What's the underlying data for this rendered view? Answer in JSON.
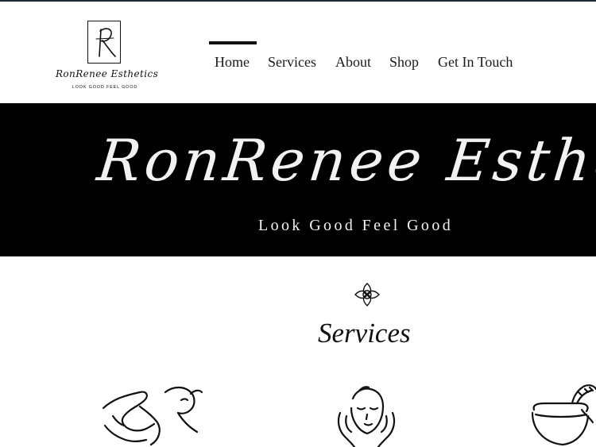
{
  "brand": {
    "logo_letter": "R",
    "name": "RonRenee Esthetics",
    "tagline": "LOOK GOOD FEEL GOOD"
  },
  "nav": {
    "items": [
      {
        "label": "Home",
        "active": true
      },
      {
        "label": "Services",
        "active": false
      },
      {
        "label": "About",
        "active": false
      },
      {
        "label": "Shop",
        "active": false
      },
      {
        "label": "Get In Touch",
        "active": false
      }
    ]
  },
  "hero": {
    "title": "RonRenee Esthetics",
    "tagline": "Look Good Feel Good"
  },
  "services": {
    "heading": "Services",
    "icon": "lotus-knot-icon",
    "illustrations": [
      "massage-hands-icon",
      "facial-treatment-icon",
      "wax-bowl-icon"
    ]
  },
  "colors": {
    "background": "#ffffff",
    "hero_background": "#000000",
    "text": "#111111",
    "top_rule": "#1e2a33"
  }
}
